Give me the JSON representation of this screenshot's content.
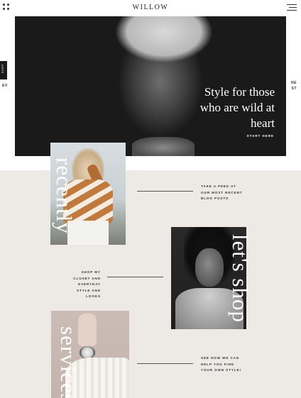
{
  "header": {
    "logo": "WILLOW",
    "grid_icon": "grid-dots-icon",
    "menu_icon": "hamburger-menu-icon"
  },
  "side": {
    "left_tab": "SHOP",
    "left_tiny": "PE",
    "right_tiny": "NE",
    "left_tiny2": "EV",
    "right_tiny2": "ST"
  },
  "hero": {
    "title_line1": "Style for those",
    "title_line2": "who are wild at",
    "title_line3": "heart",
    "cta": "START HERE"
  },
  "sections": {
    "recently": {
      "script": "recently",
      "blurb": [
        "TAKE A PEEK AT",
        "OUR MOST RECENT",
        "BLOG POSTS"
      ]
    },
    "lets_shop": {
      "script": "let's shop",
      "blurb": [
        "SHOP MY",
        "CLOSET AND",
        "EVERYDAY",
        "STYLE AND",
        "LOOKS"
      ]
    },
    "services": {
      "script": "services",
      "blurb": [
        "SEE HOW WE CAN",
        "HELP YOU FIND",
        "YOUR OWN STYLE!"
      ]
    }
  },
  "colors": {
    "beige_bg": "#edeae6",
    "hero_text": "#ffffff",
    "dark": "#1b1b1b"
  }
}
